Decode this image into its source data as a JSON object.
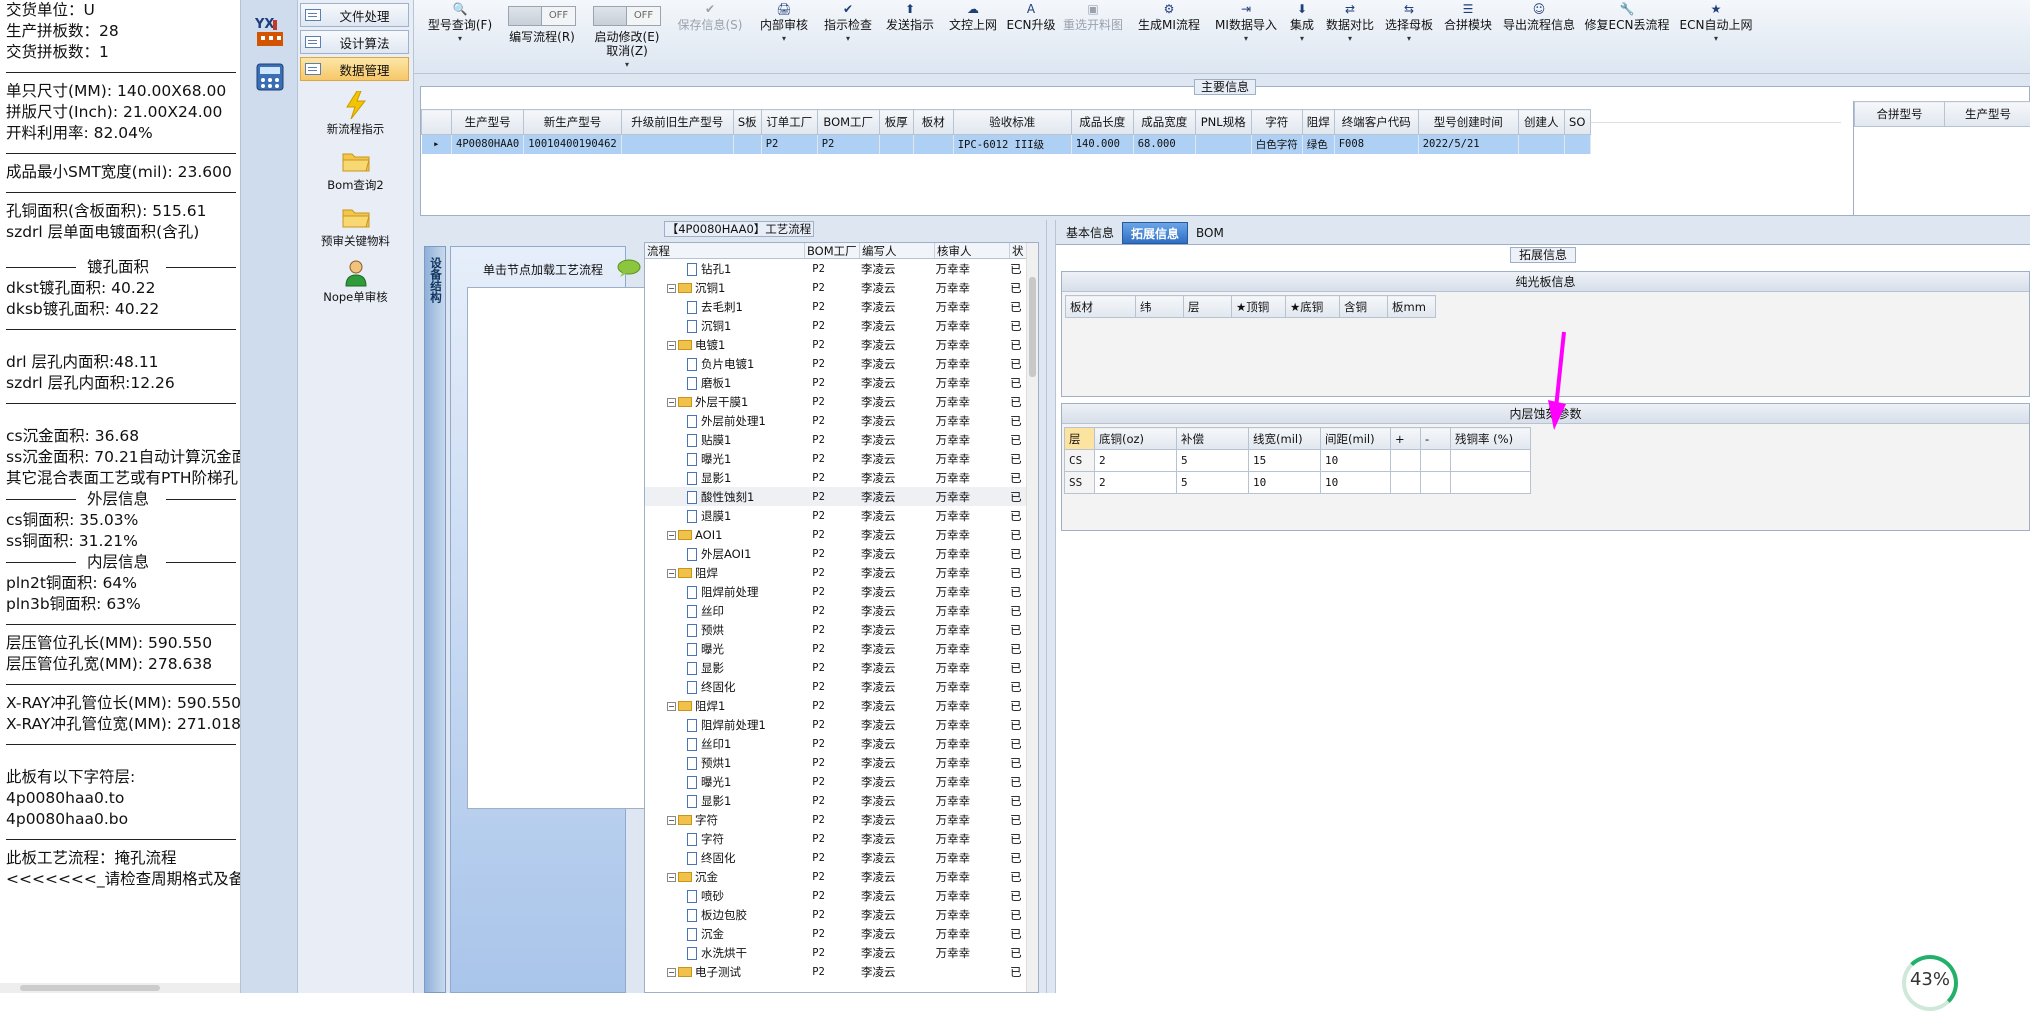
{
  "left_panel": {
    "lines_top": [
      "交货单位：U",
      "生产拼板数：28",
      "交货拼板数：1"
    ],
    "lines_size": [
      "单只尺寸(MM): 140.00X68.00",
      "拼版尺寸(Inch): 21.00X24.00",
      "开料利用率: 82.04%"
    ],
    "smt": "成品最小SMT宽度(mil): 23.600",
    "copper": [
      "孔铜面积(含板面积): 515.61",
      "szdrl          层单面电镀面积(含孔)"
    ],
    "plating_title": "镀孔面积",
    "plating": [
      "dkst镀孔面积: 40.22",
      "dksb镀孔面积: 40.22"
    ],
    "inner_hole": [
      "drl            层孔内面积:48.11",
      "szdrl          层孔内面积:12.26"
    ],
    "gold": [
      "cs沉金面积: 36.68",
      "ss沉金面积: 70.21自动计算沉金面",
      "其它混合表面工艺或有PTH阶梯孔"
    ],
    "outer_title": "外层信息",
    "outer": [
      "cs铜面积: 35.03%",
      "ss铜面积: 31.21%"
    ],
    "inner_title": "内层信息",
    "inner": [
      "pln2t铜面积: 64%",
      "pln3b铜面积: 63%"
    ],
    "press": [
      "层压管位孔长(MM): 590.550",
      "层压管位孔宽(MM): 278.638"
    ],
    "xray": [
      "X-RAY冲孔管位长(MM): 590.550",
      "X-RAY冲孔管位宽(MM): 271.018"
    ],
    "char_layers": [
      "此板有以下字符层:",
      "4p0080haa0.to",
      "4p0080haa0.bo"
    ],
    "flow": [
      "此板工艺流程：掩孔流程",
      "<<<<<<<_请检查周期格式及备"
    ]
  },
  "rail": {
    "logo_text": "YX"
  },
  "nav": {
    "tabs": [
      "文件处理",
      "设计算法",
      "数据管理"
    ],
    "items": [
      "新流程指示",
      "Bom查询2",
      "预审关键物料",
      "Nope单审核"
    ]
  },
  "toolbar": {
    "items": [
      "型号查询(F)",
      "编写流程(R)",
      "启动修改(E)",
      "取消(Z)",
      "保存信息(S)",
      "内部审核",
      "指示检查",
      "发送指示",
      "文控上网",
      "ECN升级",
      "重选开料图",
      "生成MI流程",
      "MI数据导入",
      "集成",
      "数据对比",
      "选择母板",
      "合拼模块",
      "导出流程信息",
      "修复ECN丢流程",
      "ECN自动上网"
    ],
    "toggle_off": "OFF"
  },
  "main_info": {
    "title": "主要信息",
    "columns": [
      "生产型号",
      "新生产型号",
      "升级前旧生产型号",
      "S板",
      "订单工厂",
      "BOM工厂",
      "板厚",
      "板材",
      "验收标准",
      "成品长度",
      "成品宽度",
      "PNL规格",
      "字符",
      "阻焊",
      "终端客户代码",
      "型号创建时间",
      "创建人",
      "SO"
    ],
    "row": [
      "4P0080HAA0",
      "10010400190462",
      "",
      "",
      "P2",
      "P2",
      "",
      "",
      "IPC-6012 III级",
      "140.000",
      "68.000",
      "",
      "白色字符",
      "绿色",
      "F008",
      "2022/5/21",
      "",
      ""
    ],
    "merge_columns": [
      "合拼型号",
      "生产型号"
    ]
  },
  "process": {
    "title": "【4P0080HAA0】工艺流程",
    "vtab": "设备结构",
    "hint": "单击节点加载工艺流程",
    "columns": [
      "流程",
      "BOM工厂",
      "编写人",
      "核审人",
      "状"
    ],
    "rows": [
      {
        "indent": 2,
        "type": "doc",
        "name": "钻孔1",
        "bom": "P2",
        "writer": "李凌云",
        "reviewer": "万幸幸",
        "st": "已"
      },
      {
        "indent": 1,
        "type": "folder",
        "name": "沉铜1",
        "bom": "P2",
        "writer": "李凌云",
        "reviewer": "万幸幸",
        "st": "已"
      },
      {
        "indent": 2,
        "type": "doc",
        "name": "去毛刺1",
        "bom": "P2",
        "writer": "李凌云",
        "reviewer": "万幸幸",
        "st": "已"
      },
      {
        "indent": 2,
        "type": "doc",
        "name": "沉铜1",
        "bom": "P2",
        "writer": "李凌云",
        "reviewer": "万幸幸",
        "st": "已"
      },
      {
        "indent": 1,
        "type": "folder",
        "name": "电镀1",
        "bom": "P2",
        "writer": "李凌云",
        "reviewer": "万幸幸",
        "st": "已"
      },
      {
        "indent": 2,
        "type": "doc",
        "name": "负片电镀1",
        "bom": "P2",
        "writer": "李凌云",
        "reviewer": "万幸幸",
        "st": "已"
      },
      {
        "indent": 2,
        "type": "doc",
        "name": "磨板1",
        "bom": "P2",
        "writer": "李凌云",
        "reviewer": "万幸幸",
        "st": "已"
      },
      {
        "indent": 1,
        "type": "folder",
        "name": "外层干膜1",
        "bom": "P2",
        "writer": "李凌云",
        "reviewer": "万幸幸",
        "st": "已"
      },
      {
        "indent": 2,
        "type": "doc",
        "name": "外层前处理1",
        "bom": "P2",
        "writer": "李凌云",
        "reviewer": "万幸幸",
        "st": "已"
      },
      {
        "indent": 2,
        "type": "doc",
        "name": "贴膜1",
        "bom": "P2",
        "writer": "李凌云",
        "reviewer": "万幸幸",
        "st": "已"
      },
      {
        "indent": 2,
        "type": "doc",
        "name": "曝光1",
        "bom": "P2",
        "writer": "李凌云",
        "reviewer": "万幸幸",
        "st": "已"
      },
      {
        "indent": 2,
        "type": "doc",
        "name": "显影1",
        "bom": "P2",
        "writer": "李凌云",
        "reviewer": "万幸幸",
        "st": "已"
      },
      {
        "indent": 2,
        "type": "doc",
        "name": "酸性蚀刻1",
        "bom": "P2",
        "writer": "李凌云",
        "reviewer": "万幸幸",
        "st": "已",
        "sel": true
      },
      {
        "indent": 2,
        "type": "doc",
        "name": "退膜1",
        "bom": "P2",
        "writer": "李凌云",
        "reviewer": "万幸幸",
        "st": "已"
      },
      {
        "indent": 1,
        "type": "folder",
        "name": "AOI1",
        "bom": "P2",
        "writer": "李凌云",
        "reviewer": "万幸幸",
        "st": "已"
      },
      {
        "indent": 2,
        "type": "doc",
        "name": "外层AOI1",
        "bom": "P2",
        "writer": "李凌云",
        "reviewer": "万幸幸",
        "st": "已"
      },
      {
        "indent": 1,
        "type": "folder",
        "name": "阻焊",
        "bom": "P2",
        "writer": "李凌云",
        "reviewer": "万幸幸",
        "st": "已"
      },
      {
        "indent": 2,
        "type": "doc",
        "name": "阻焊前处理",
        "bom": "P2",
        "writer": "李凌云",
        "reviewer": "万幸幸",
        "st": "已"
      },
      {
        "indent": 2,
        "type": "doc",
        "name": "丝印",
        "bom": "P2",
        "writer": "李凌云",
        "reviewer": "万幸幸",
        "st": "已"
      },
      {
        "indent": 2,
        "type": "doc",
        "name": "预烘",
        "bom": "P2",
        "writer": "李凌云",
        "reviewer": "万幸幸",
        "st": "已"
      },
      {
        "indent": 2,
        "type": "doc",
        "name": "曝光",
        "bom": "P2",
        "writer": "李凌云",
        "reviewer": "万幸幸",
        "st": "已"
      },
      {
        "indent": 2,
        "type": "doc",
        "name": "显影",
        "bom": "P2",
        "writer": "李凌云",
        "reviewer": "万幸幸",
        "st": "已"
      },
      {
        "indent": 2,
        "type": "doc",
        "name": "终固化",
        "bom": "P2",
        "writer": "李凌云",
        "reviewer": "万幸幸",
        "st": "已"
      },
      {
        "indent": 1,
        "type": "folder",
        "name": "阻焊1",
        "bom": "P2",
        "writer": "李凌云",
        "reviewer": "万幸幸",
        "st": "已"
      },
      {
        "indent": 2,
        "type": "doc",
        "name": "阻焊前处理1",
        "bom": "P2",
        "writer": "李凌云",
        "reviewer": "万幸幸",
        "st": "已"
      },
      {
        "indent": 2,
        "type": "doc",
        "name": "丝印1",
        "bom": "P2",
        "writer": "李凌云",
        "reviewer": "万幸幸",
        "st": "已"
      },
      {
        "indent": 2,
        "type": "doc",
        "name": "预烘1",
        "bom": "P2",
        "writer": "李凌云",
        "reviewer": "万幸幸",
        "st": "已"
      },
      {
        "indent": 2,
        "type": "doc",
        "name": "曝光1",
        "bom": "P2",
        "writer": "李凌云",
        "reviewer": "万幸幸",
        "st": "已"
      },
      {
        "indent": 2,
        "type": "doc",
        "name": "显影1",
        "bom": "P2",
        "writer": "李凌云",
        "reviewer": "万幸幸",
        "st": "已"
      },
      {
        "indent": 1,
        "type": "folder",
        "name": "字符",
        "bom": "P2",
        "writer": "李凌云",
        "reviewer": "万幸幸",
        "st": "已"
      },
      {
        "indent": 2,
        "type": "doc",
        "name": "字符",
        "bom": "P2",
        "writer": "李凌云",
        "reviewer": "万幸幸",
        "st": "已"
      },
      {
        "indent": 2,
        "type": "doc",
        "name": "终固化",
        "bom": "P2",
        "writer": "李凌云",
        "reviewer": "万幸幸",
        "st": "已"
      },
      {
        "indent": 1,
        "type": "folder",
        "name": "沉金",
        "bom": "P2",
        "writer": "李凌云",
        "reviewer": "万幸幸",
        "st": "已"
      },
      {
        "indent": 2,
        "type": "doc",
        "name": "喷砂",
        "bom": "P2",
        "writer": "李凌云",
        "reviewer": "万幸幸",
        "st": "已"
      },
      {
        "indent": 2,
        "type": "doc",
        "name": "板边包胶",
        "bom": "P2",
        "writer": "李凌云",
        "reviewer": "万幸幸",
        "st": "已"
      },
      {
        "indent": 2,
        "type": "doc",
        "name": "沉金",
        "bom": "P2",
        "writer": "李凌云",
        "reviewer": "万幸幸",
        "st": "已"
      },
      {
        "indent": 2,
        "type": "doc",
        "name": "水洗烘干",
        "bom": "P2",
        "writer": "李凌云",
        "reviewer": "万幸幸",
        "st": "已"
      },
      {
        "indent": 1,
        "type": "folder",
        "name": "电子测试",
        "bom": "P2",
        "writer": "李凌云",
        "reviewer": "",
        "st": "已"
      }
    ]
  },
  "right": {
    "tabs": [
      "基本信息",
      "拓展信息",
      "BOM"
    ],
    "title": "拓展信息",
    "pure": {
      "title": "纯光板信息",
      "columns": [
        "板材",
        "纬",
        "层",
        "★顶铜",
        "★底铜",
        "含铜",
        "板mm"
      ]
    },
    "inner": {
      "title": "内层蚀刻参数",
      "columns": [
        "层",
        "底铜(oz)",
        "补偿",
        "线宽(mil)",
        "间距(mil)",
        "+",
        "-",
        "残铜率 (%)"
      ],
      "rows": [
        [
          "CS",
          "2",
          "5",
          "15",
          "10",
          "",
          "",
          ""
        ],
        [
          "SS",
          "2",
          "5",
          "10",
          "10",
          "",
          "",
          ""
        ]
      ]
    }
  },
  "status": {
    "percent": "43%"
  },
  "colors": {
    "accent": "#2f6fc3",
    "arrow": "#ff00ff",
    "selection": "#aed0f4"
  }
}
